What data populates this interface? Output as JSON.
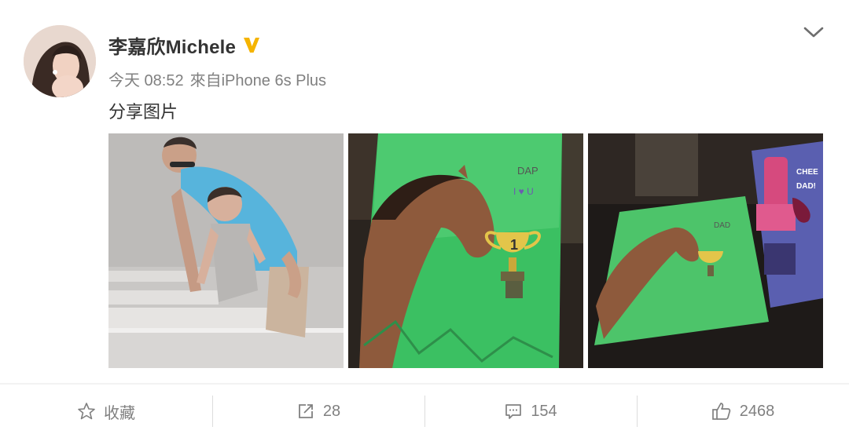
{
  "post": {
    "username": "李嘉欣Michele",
    "time": "今天 08:52",
    "source": "來自iPhone 6s Plus",
    "text": "分享图片",
    "images": [
      "photo-1",
      "photo-2",
      "photo-3"
    ]
  },
  "actions": {
    "favorite_label": "收藏",
    "repost_count": "28",
    "comment_count": "154",
    "like_count": "2468"
  },
  "colors": {
    "verified": "#f5b400",
    "meta_gray": "#808080",
    "divider": "#dcdcdc"
  },
  "icons": {
    "verified": "verified-v-icon",
    "expand": "chevron-down-icon",
    "favorite": "star-icon",
    "repost": "share-arrow-icon",
    "comment": "comment-bubble-icon",
    "like": "thumbs-up-icon"
  }
}
